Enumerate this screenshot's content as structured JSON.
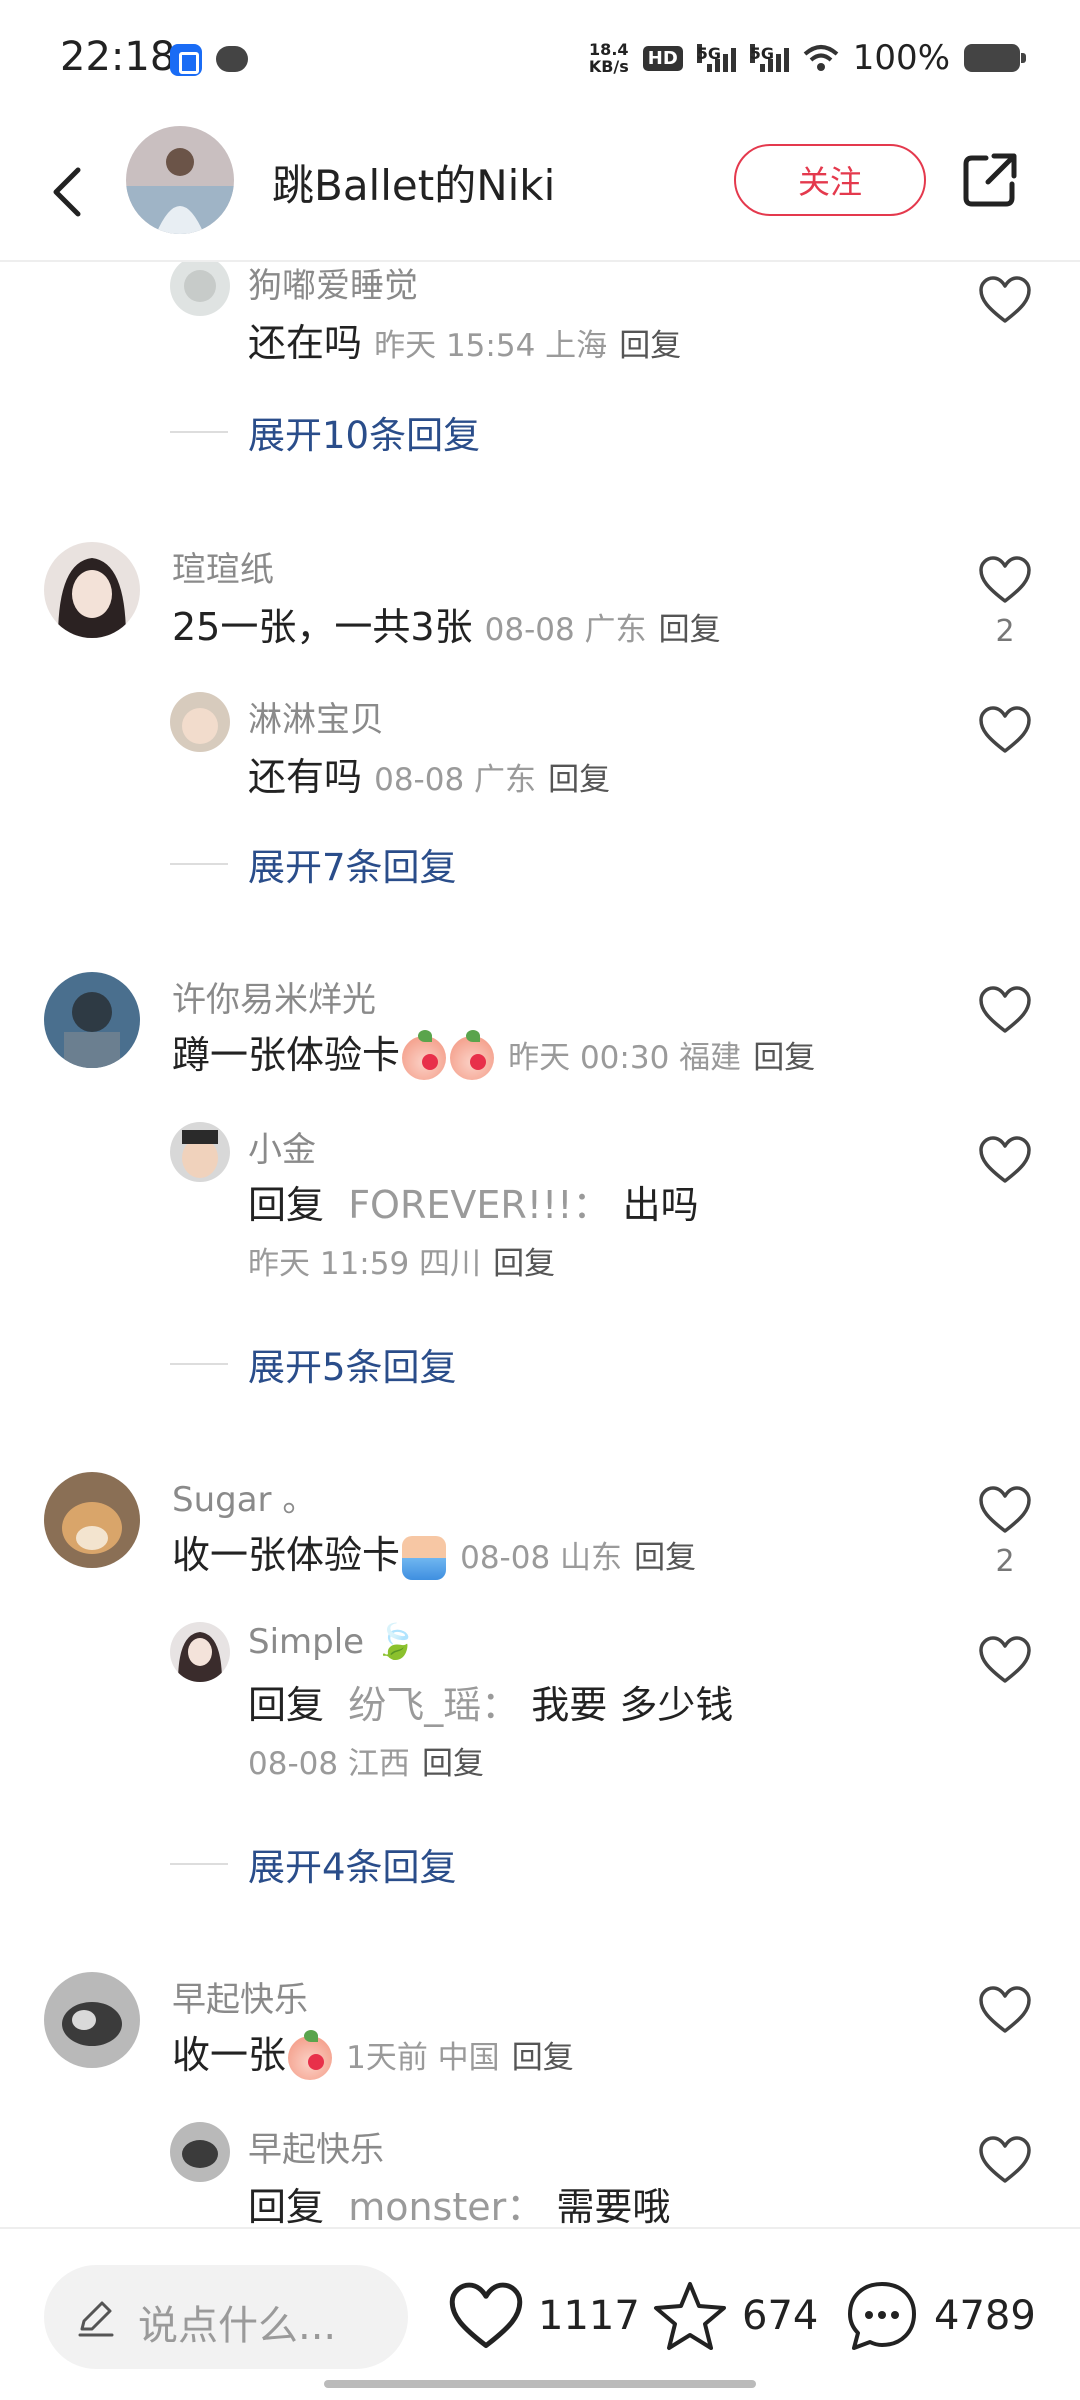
{
  "status": {
    "time": "22:18",
    "net_speed": "18.4",
    "net_unit": "KB/s",
    "hd": "HD",
    "sim1": "5G",
    "sim2": "5G",
    "battery": "100%"
  },
  "header": {
    "name": "跳Ballet的Niki",
    "follow": "关注"
  },
  "comments": [
    {
      "type": "reply",
      "user": "狗嘟爱睡觉",
      "text": "还在吗",
      "meta": "昨天 15:54 上海",
      "reply": "回复"
    },
    {
      "type": "expand",
      "text": "展开10条回复"
    },
    {
      "type": "top",
      "user": "瑄瑄纸",
      "text": "25一张，一共3张",
      "meta": "08-08 广东",
      "reply": "回复",
      "likes": "2"
    },
    {
      "type": "reply",
      "user": "淋淋宝贝",
      "text": "还有吗",
      "meta": "08-08 广东",
      "reply": "回复"
    },
    {
      "type": "expand",
      "text": "展开7条回复"
    },
    {
      "type": "top",
      "user": "许你易米烊光",
      "text": "蹲一张体验卡",
      "meta": "昨天 00:30 福建",
      "reply": "回复"
    },
    {
      "type": "reply",
      "user": "小金",
      "prefix": "回复",
      "quote": "FOREVER!!!：",
      "text": "出吗",
      "meta": "昨天 11:59 四川",
      "reply": "回复"
    },
    {
      "type": "expand",
      "text": "展开5条回复"
    },
    {
      "type": "top",
      "user": "Sugar 。",
      "text": "收一张体验卡",
      "meta": "08-08 山东",
      "reply": "回复",
      "likes": "2"
    },
    {
      "type": "reply",
      "user": "Simple",
      "prefix": "回复",
      "quote": "纷飞_瑶：",
      "text": "我要 多少钱",
      "meta": "08-08 江西",
      "reply": "回复"
    },
    {
      "type": "expand",
      "text": "展开4条回复"
    },
    {
      "type": "top",
      "user": "早起快乐",
      "text": "收一张",
      "meta": "1天前  中国",
      "reply": "回复"
    },
    {
      "type": "reply",
      "user": "早起快乐",
      "prefix": "回复",
      "quote": "monster：",
      "text": "需要哦"
    }
  ],
  "bottom": {
    "placeholder": "说点什么...",
    "likes": "1117",
    "favorites": "674",
    "comments": "4789"
  },
  "colors": {
    "accent": "#e4394d",
    "expand_link": "#2a4d8a",
    "meta_gray": "#9a9a9a"
  }
}
